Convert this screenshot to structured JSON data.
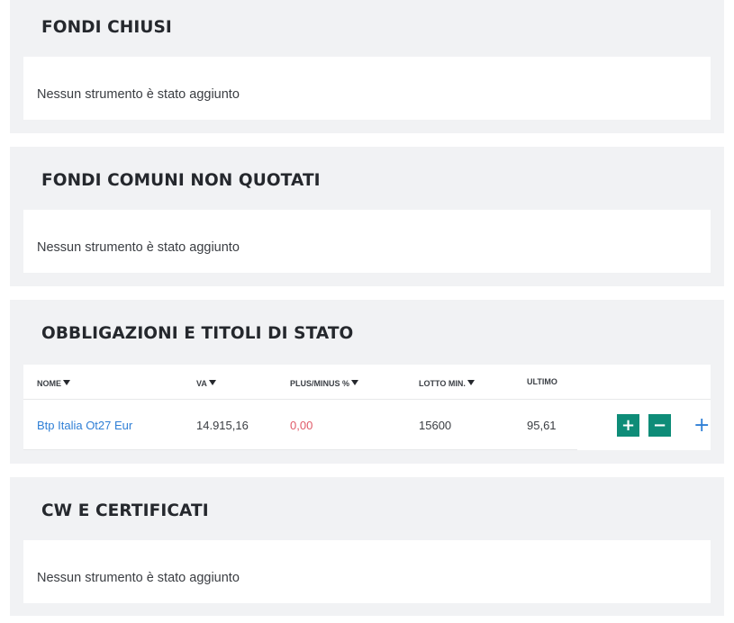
{
  "sections": [
    {
      "title": "FONDI CHIUSI",
      "empty_message": "Nessun strumento è stato aggiunto"
    },
    {
      "title": "FONDI COMUNI NON QUOTATI",
      "empty_message": "Nessun strumento è stato aggiunto"
    },
    {
      "title": "OBBLIGAZIONI E TITOLI DI STATO",
      "columns": [
        {
          "label": "NOME",
          "sortable": true
        },
        {
          "label": "VA",
          "sortable": true
        },
        {
          "label": "PLUS/MINUS %",
          "sortable": true
        },
        {
          "label": "LOTTO MIN.",
          "sortable": true
        },
        {
          "label": "ULTIMO",
          "sortable": false
        }
      ],
      "rows": [
        {
          "nome": "Btp Italia Ot27 Eur",
          "va": "14.915,16",
          "plus_minus": "0,00",
          "lotto_min": "15600",
          "ultimo": "95,61",
          "buy_label": "+",
          "sell_label": "−",
          "add_label": "+"
        }
      ]
    },
    {
      "title": "CW E CERTIFICATI",
      "empty_message": "Nessun strumento è stato aggiunto"
    }
  ],
  "colors": {
    "panel_bg": "#f1f2f4",
    "accent_green": "#0e8c78",
    "link_blue": "#2f7fd6",
    "negative_red": "#e05a68"
  },
  "icons": {
    "sort": "caret-down-icon",
    "buy": "plus-icon",
    "sell": "minus-icon",
    "add": "plus-icon"
  }
}
